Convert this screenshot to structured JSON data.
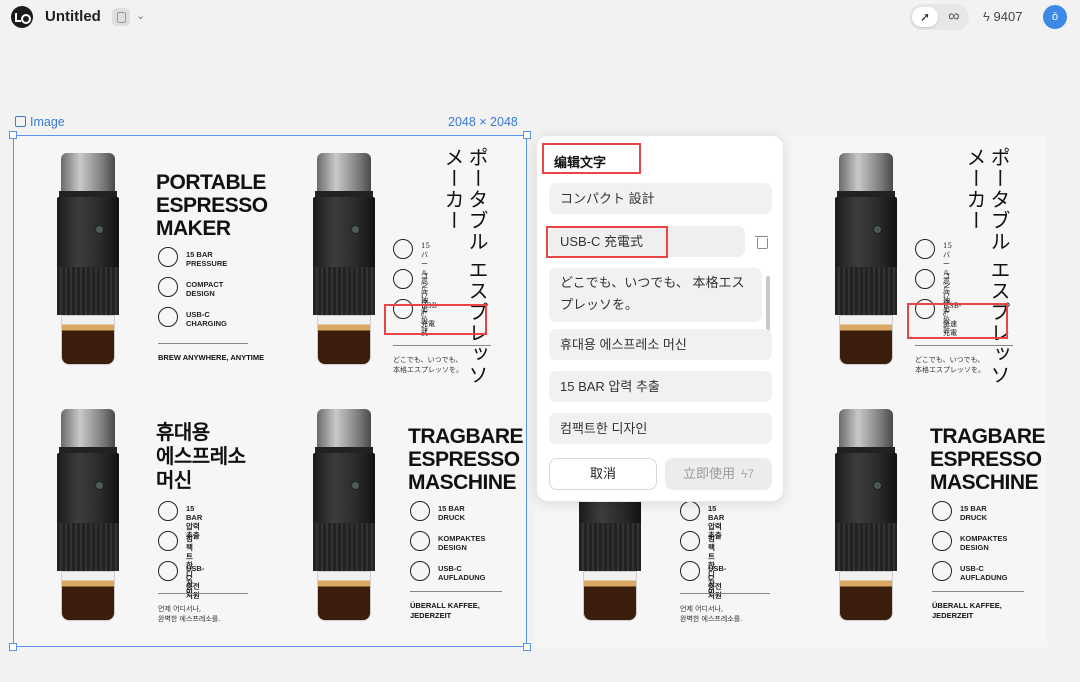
{
  "header": {
    "title": "Untitled",
    "credits": "9407",
    "avatar_initial": "ō"
  },
  "frame": {
    "label": "Image",
    "dimensions": "2048 × 2048"
  },
  "poster_left": {
    "en": {
      "title": "PORTABLE\nESPRESSO\nMAKER",
      "features": [
        "15 BAR\nPRESSURE",
        "COMPACT\nDESIGN",
        "USB-C\nCHARGING"
      ],
      "tagline": "BREW ANYWHERE, ANYTIME"
    },
    "jp": {
      "title": "ポータブル\nエスプレッソ\nメーカー",
      "features": [
        "15 バール\n高圧抽出",
        "コンパクト\n設計",
        "USB-C\n充電式"
      ],
      "tagline": "どこでも、いつでも、\n本格エスプレッソを。"
    },
    "ko": {
      "title": "휴대용\n에스프레소\n머신",
      "features": [
        "15 BAR\n압력 추출",
        "컴팩트한\n디자인",
        "USB-C\n충전 지원"
      ],
      "tagline": "언제 어디서나,\n완벽한 에스프레소를."
    },
    "de": {
      "title": "TRAGBARE\nESPRESSO\nMASCHINE",
      "features": [
        "15 BAR\nDRUCK",
        "KOMPAKTES\nDESIGN",
        "USB-C\nAUFLADUNG"
      ],
      "tagline": "ÜBERALL KAFFEE,\nJEDERZEIT"
    }
  },
  "poster_right": {
    "jp": {
      "title": "ポータブル\nエスプレッソ\nメーカー",
      "features": [
        "15 バール\n高圧抽出",
        "コンパクト\n設計",
        "USB-C\n急速充電"
      ],
      "tagline": "どこでも、いつでも、\n本格エスプレッソを。"
    },
    "ko": {
      "features": [
        "15 BAR\n압력 추출",
        "컴팩트한\n디자인",
        "USB-C\n충전 지원"
      ],
      "tagline": "언제 어디서나,\n완벽한 에스프레소를."
    },
    "de": {
      "title": "TRAGBARE\nESPRESSO\nMASCHINE",
      "features": [
        "15 BAR\nDRUCK",
        "KOMPAKTES\nDESIGN",
        "USB-C\nAUFLADUNG"
      ],
      "tagline": "ÜBERALL KAFFEE,\nJEDERZEIT"
    }
  },
  "edit_panel": {
    "title": "编辑文字",
    "fields": [
      "コンパクト 設計",
      "USB-C 充電式",
      "どこでも、いつでも、 本格エスプレッソを。",
      "휴대용 에스프레소 머신",
      "15 BAR 압력 추출",
      "컴팩트한 디자인"
    ],
    "cancel_label": "取消",
    "apply_label": "立即使用",
    "apply_cost": "7"
  },
  "colors": {
    "selection": "#5b95e8",
    "highlight": "#e84646",
    "avatar": "#3d8ae6"
  }
}
